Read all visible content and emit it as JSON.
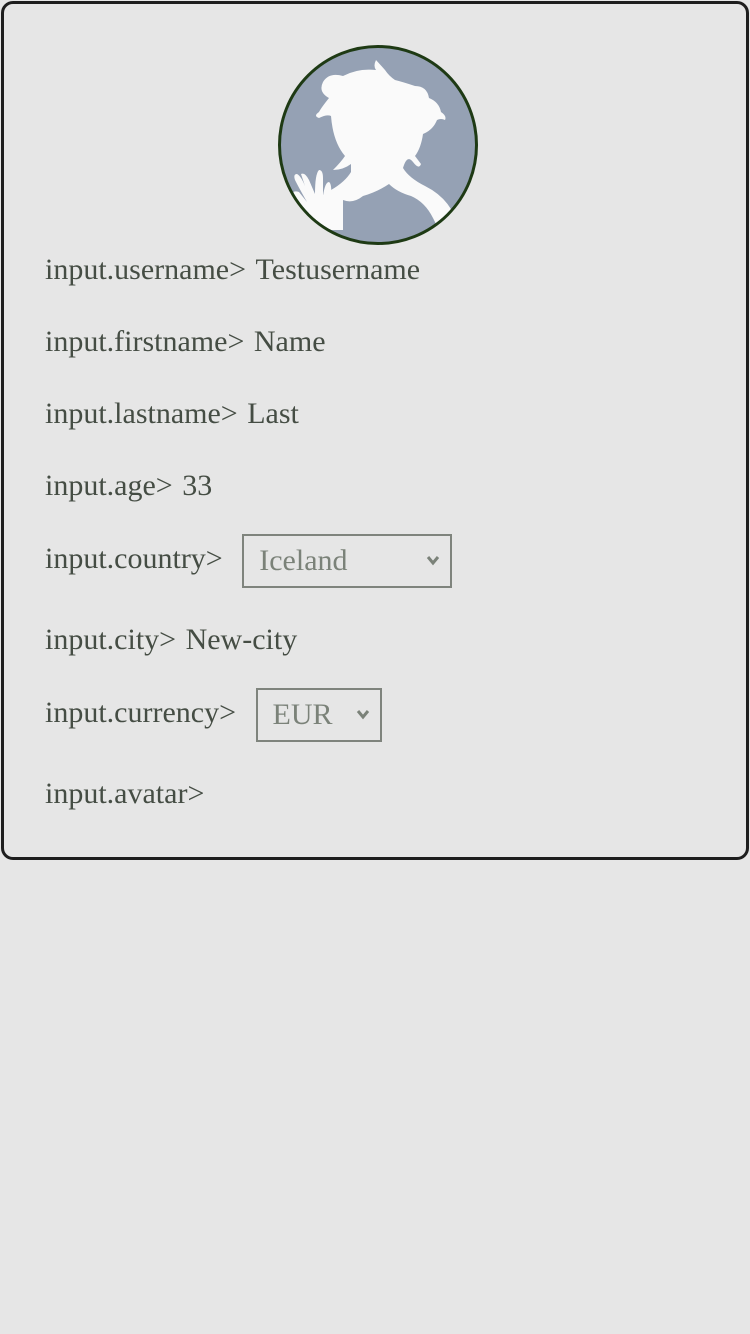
{
  "profile": {
    "avatar_icon": "user-silhouette-avatar",
    "username": {
      "label": "input.username>",
      "value": "Testusername"
    },
    "firstname": {
      "label": "input.firstname>",
      "value": "Name"
    },
    "lastname": {
      "label": "input.lastname>",
      "value": "Last"
    },
    "age": {
      "label": "input.age>",
      "value": "33"
    },
    "country": {
      "label": "input.country>",
      "selected": "Iceland"
    },
    "city": {
      "label": "input.city>",
      "value": "New-city"
    },
    "currency": {
      "label": "input.currency>",
      "selected": "EUR"
    },
    "avatar": {
      "label": "input.avatar>"
    }
  },
  "colors": {
    "background": "#e6e6e6",
    "card_border": "#1e1e1e",
    "avatar_border": "#1e3a14",
    "avatar_bg": "#95a1b4",
    "text": "#454d44"
  }
}
